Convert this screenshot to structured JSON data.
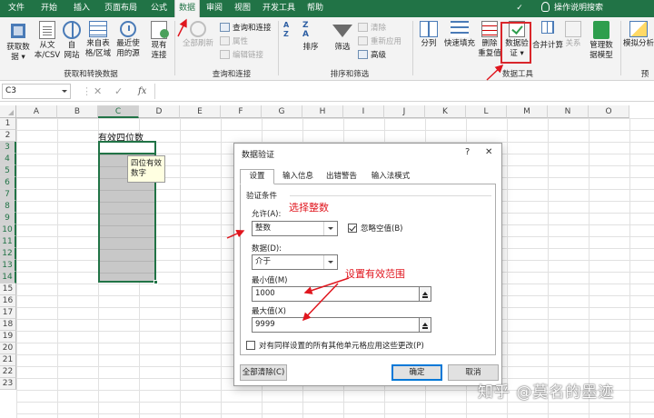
{
  "tabs": [
    {
      "label": "文件"
    },
    {
      "label": "开始"
    },
    {
      "label": "插入"
    },
    {
      "label": "页面布局"
    },
    {
      "label": "公式"
    },
    {
      "label": "数据",
      "active": true
    },
    {
      "label": "审阅"
    },
    {
      "label": "视图"
    },
    {
      "label": "开发工具"
    },
    {
      "label": "帮助"
    },
    {
      "label": "✓"
    }
  ],
  "tell_me": "操作说明搜索",
  "ribbon": {
    "get_data": {
      "line1": "获取数",
      "line2": "据 ▾"
    },
    "from_csv": {
      "line1": "从文",
      "line2": "本/CSV"
    },
    "from_web": {
      "line1": "自",
      "line2": "网站"
    },
    "from_table": {
      "line1": "来自表",
      "line2": "格/区域"
    },
    "recent_sources": {
      "line1": "最近使",
      "line2": "用的源"
    },
    "existing_conn": {
      "line1": "现有",
      "line2": "连接"
    },
    "group_get_transform": "获取和转换数据",
    "refresh_all": "全部刷新",
    "queries_conn": "查询和连接",
    "properties": "属性",
    "edit_links": "编辑链接",
    "group_queries": "查询和连接",
    "sort": "排序",
    "filter": "筛选",
    "clear": "清除",
    "reapply": "重新应用",
    "advanced": "高级",
    "group_sort_filter": "排序和筛选",
    "text_to_cols": "分列",
    "flash_fill": "快速填充",
    "remove_dup": {
      "line1": "删除",
      "line2": "重复值"
    },
    "data_validation": {
      "line1": "数据验",
      "line2": "证 ▾"
    },
    "consolidate": "合并计算",
    "relationships": "关系",
    "manage_model": {
      "line1": "管理数",
      "line2": "据模型"
    },
    "group_data_tools": "数据工具",
    "what_if": "模拟分析",
    "group_forecast": "预"
  },
  "formula_bar": {
    "name_box": "C3",
    "cancel": "✕",
    "enter": "✓",
    "fx": "fx",
    "value": ""
  },
  "columns": [
    "A",
    "B",
    "C",
    "D",
    "E",
    "F",
    "G",
    "H",
    "I",
    "J",
    "K",
    "L",
    "M",
    "N",
    "O"
  ],
  "rows": [
    "1",
    "2",
    "3",
    "4",
    "5",
    "6",
    "7",
    "8",
    "9",
    "10",
    "11",
    "12",
    "13",
    "14",
    "15",
    "16",
    "17",
    "18",
    "19",
    "20",
    "21",
    "22",
    "23"
  ],
  "cells": {
    "B2": "有效四位数"
  },
  "input_tip": {
    "line1": "四位有效",
    "line2": "数字"
  },
  "dialog": {
    "title": "数据验证",
    "help": "?",
    "close": "✕",
    "tabs": [
      "设置",
      "输入信息",
      "出错警告",
      "输入法模式"
    ],
    "section": "验证条件",
    "allow_label": "允许(A):",
    "allow_value": "整数",
    "ignore_blank": "忽略空值(B)",
    "data_label": "数据(D):",
    "data_value": "介于",
    "min_label": "最小值(M)",
    "min_value": "1000",
    "max_label": "最大值(X)",
    "max_value": "9999",
    "apply_all": "对有同样设置的所有其他单元格应用这些更改(P)",
    "clear_all": "全部清除(C)",
    "ok": "确定",
    "cancel": "取消"
  },
  "annotations": {
    "choose_integer": "选择整数",
    "set_range": "设置有效范围"
  },
  "watermark": "知乎 @莫名的墨迹",
  "colors": {
    "excel_green": "#217346",
    "annotation_red": "#e0161e"
  }
}
